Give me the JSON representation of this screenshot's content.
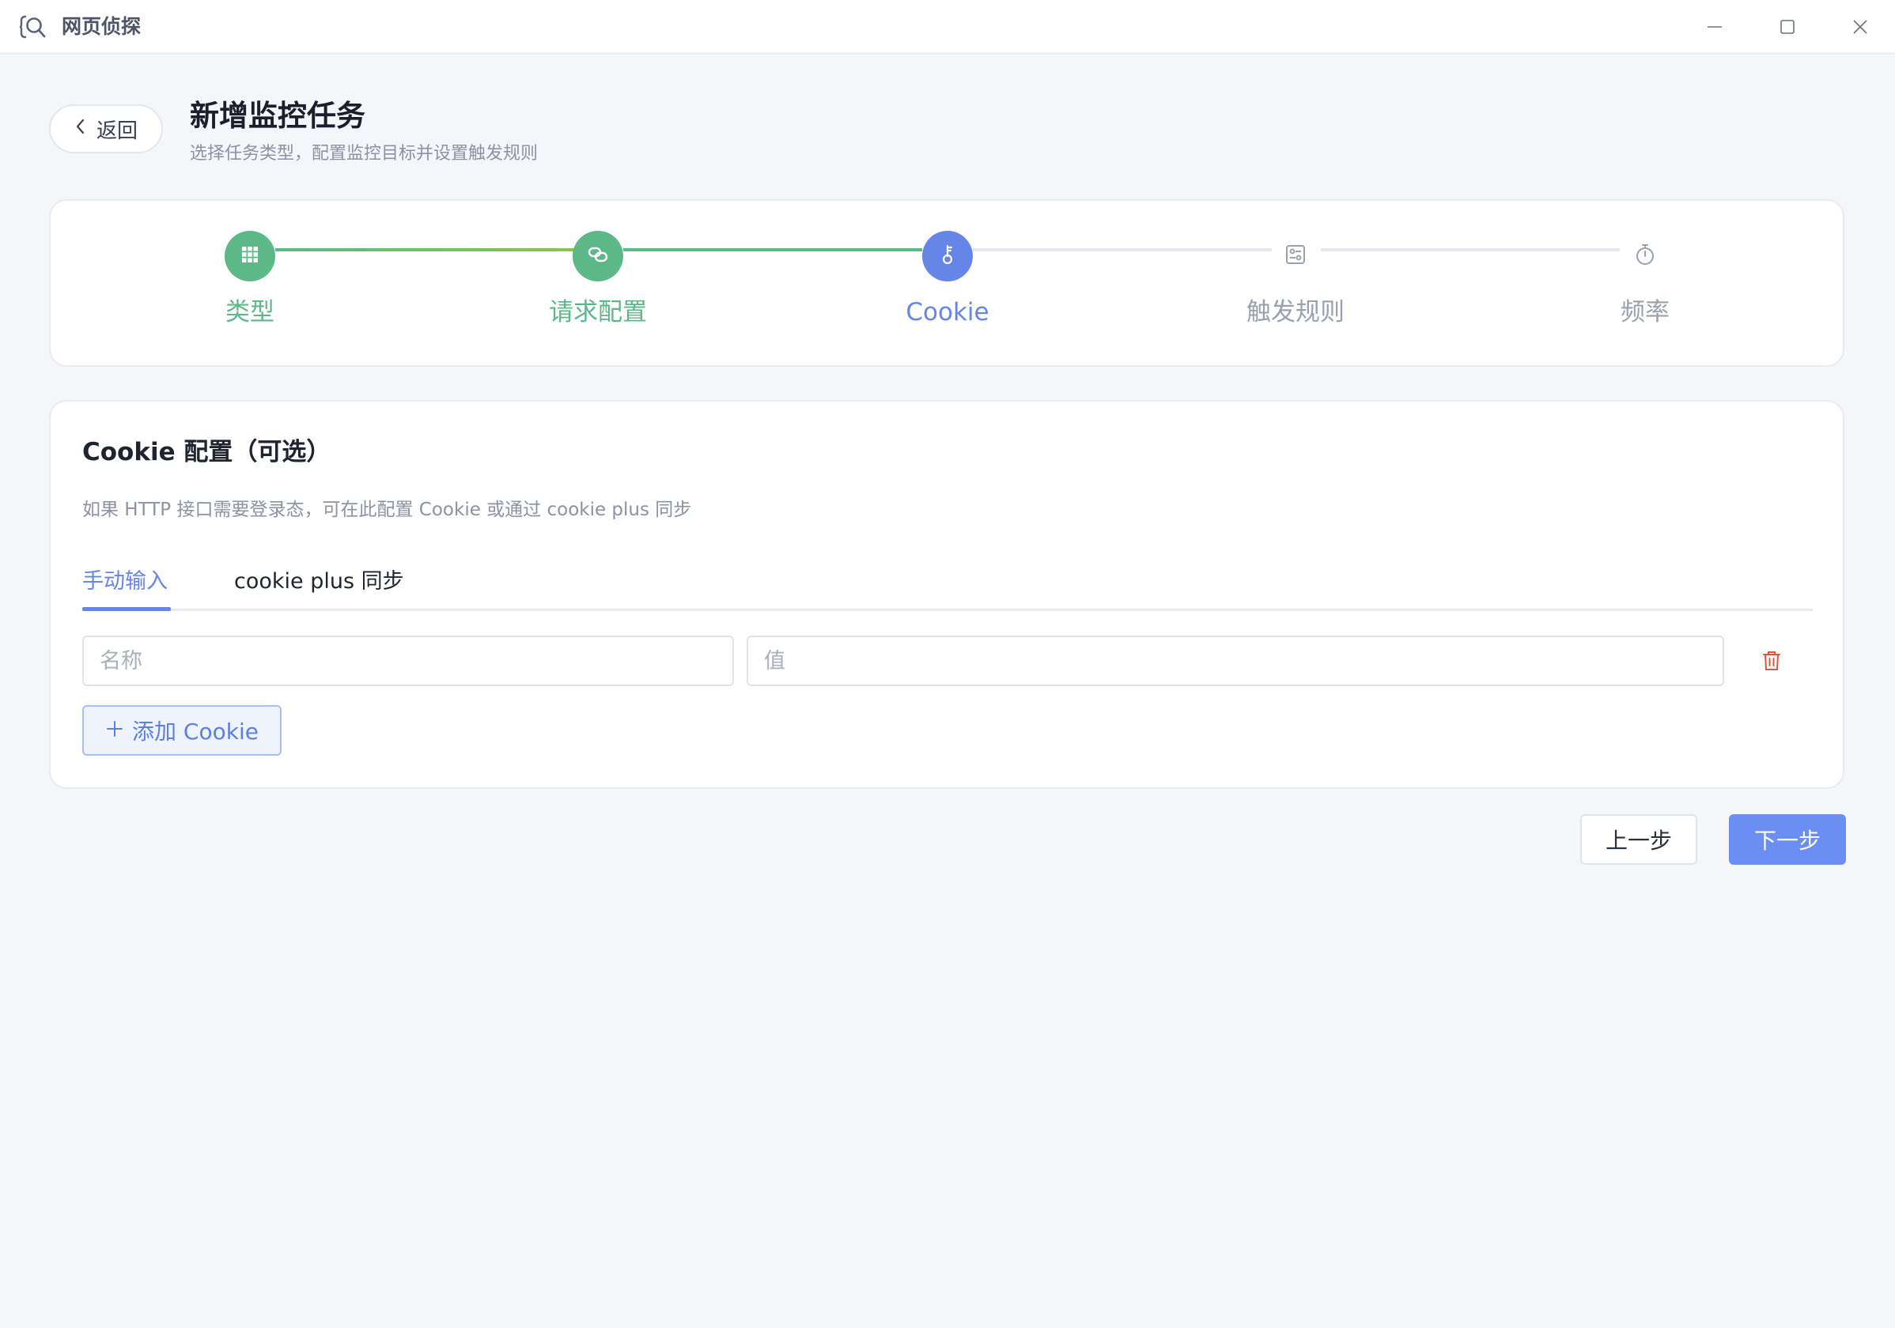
{
  "window": {
    "title": "网页侦探"
  },
  "header": {
    "back_label": "返回",
    "title": "新增监控任务",
    "subtitle": "选择任务类型，配置监控目标并设置触发规则"
  },
  "steps": [
    {
      "label": "类型",
      "status": "done",
      "icon": "grid-icon"
    },
    {
      "label": "请求配置",
      "status": "done",
      "icon": "link-icon"
    },
    {
      "label": "Cookie",
      "status": "active",
      "icon": "key-icon"
    },
    {
      "label": "触发规则",
      "status": "pending",
      "icon": "rules-icon"
    },
    {
      "label": "频率",
      "status": "pending",
      "icon": "stopwatch-icon"
    }
  ],
  "cookie_section": {
    "title": "Cookie 配置（可选）",
    "description": "如果 HTTP 接口需要登录态，可在此配置 Cookie 或通过 cookie plus 同步",
    "tabs": [
      {
        "label": "手动输入",
        "active": true
      },
      {
        "label": "cookie plus 同步",
        "active": false
      }
    ],
    "row": {
      "name_placeholder": "名称",
      "name_value": "",
      "value_placeholder": "值",
      "value_value": ""
    },
    "add_label": "添加 Cookie"
  },
  "footer": {
    "prev_label": "上一步",
    "next_label": "下一步"
  },
  "colors": {
    "done": "#5cb887",
    "active": "#6585e8",
    "pending": "#9aa1ae",
    "delete": "#e0533c"
  }
}
